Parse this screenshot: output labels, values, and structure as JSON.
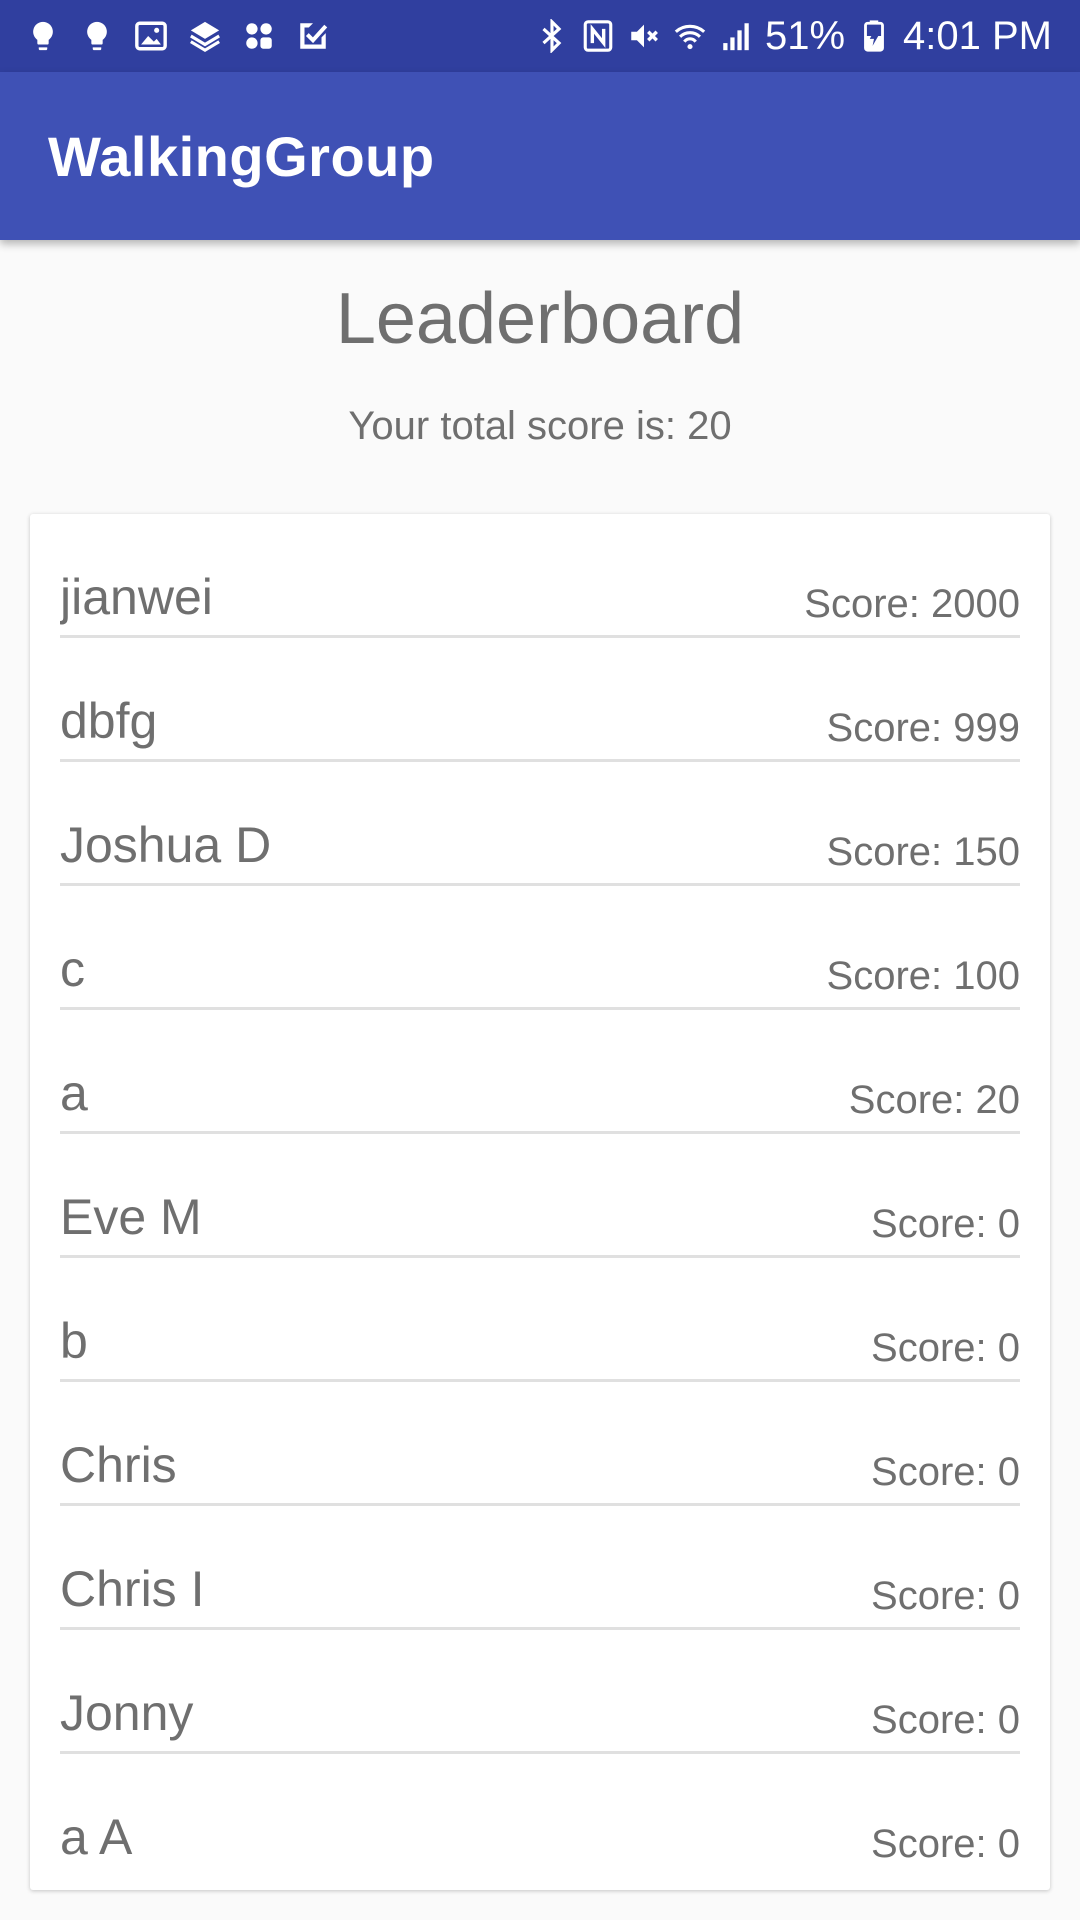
{
  "status_bar": {
    "left_icons": [
      "bulb-icon",
      "bulb-icon",
      "image-icon",
      "layers-icon",
      "apps-icon",
      "checkmark-icon"
    ],
    "right_icons": [
      "bluetooth-icon",
      "nfc-icon",
      "mute-icon",
      "wifi-icon",
      "signal-icon",
      "battery-charging-icon"
    ],
    "battery": "51%",
    "time": "4:01 PM"
  },
  "app_bar": {
    "title": "WalkingGroup"
  },
  "main": {
    "title": "Leaderboard",
    "total_score": "Your total score is: 20"
  },
  "leaderboard": [
    {
      "name": "jianwei",
      "score": "Score: 2000"
    },
    {
      "name": "dbfg",
      "score": "Score: 999"
    },
    {
      "name": "Joshua D",
      "score": "Score: 150"
    },
    {
      "name": "c",
      "score": "Score: 100"
    },
    {
      "name": "a",
      "score": "Score: 20"
    },
    {
      "name": "Eve M",
      "score": "Score: 0"
    },
    {
      "name": "b",
      "score": "Score: 0"
    },
    {
      "name": "Chris",
      "score": "Score: 0"
    },
    {
      "name": "Chris I",
      "score": "Score: 0"
    },
    {
      "name": "Jonny",
      "score": "Score: 0"
    },
    {
      "name": "a A",
      "score": "Score: 0"
    }
  ],
  "colors": {
    "status_bar": "#303f9f",
    "app_bar": "#3f51b5",
    "background": "#fafafa",
    "text": "#6f6f6f",
    "divider": "#e0e0e0"
  }
}
